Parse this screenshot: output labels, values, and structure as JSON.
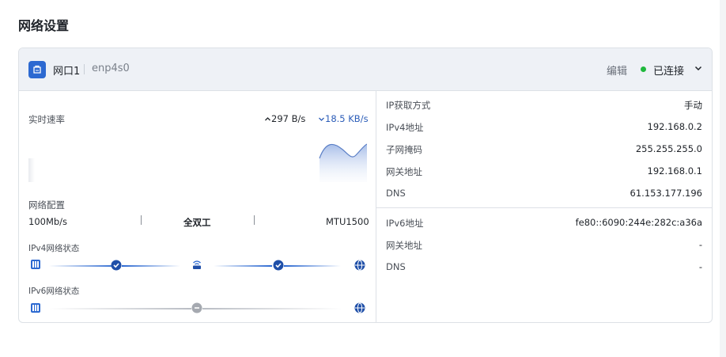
{
  "page": {
    "title": "网络设置"
  },
  "header": {
    "port_name": "网口1",
    "device": "enp4s0",
    "edit_label": "编辑",
    "status_text": "已连接",
    "status_color": "#1fb83d"
  },
  "left": {
    "speed_label": "实时速率",
    "upload_rate": "297 B/s",
    "download_rate": "18.5 KB/s",
    "config_label": "网络配置",
    "link_speed": "100Mb/s",
    "duplex": "全双工",
    "mtu": "MTU1500",
    "ipv4_status_label": "IPv4网络状态",
    "ipv6_status_label": "IPv6网络状态"
  },
  "ipv4": {
    "rows": [
      {
        "key": "IP获取方式",
        "value": "手动"
      },
      {
        "key": "IPv4地址",
        "value": "192.168.0.2"
      },
      {
        "key": "子网掩码",
        "value": "255.255.255.0"
      },
      {
        "key": "网关地址",
        "value": "192.168.0.1"
      },
      {
        "key": "DNS",
        "value": "61.153.177.196"
      }
    ]
  },
  "ipv6": {
    "rows": [
      {
        "key": "IPv6地址",
        "value": "fe80::6090:244e:282c:a36a"
      },
      {
        "key": "网关地址",
        "value": "-"
      },
      {
        "key": "DNS",
        "value": "-"
      }
    ]
  },
  "colors": {
    "accent": "#2c69d1",
    "line_active": "#2c69d1",
    "line_inactive": "#c7cad0"
  }
}
